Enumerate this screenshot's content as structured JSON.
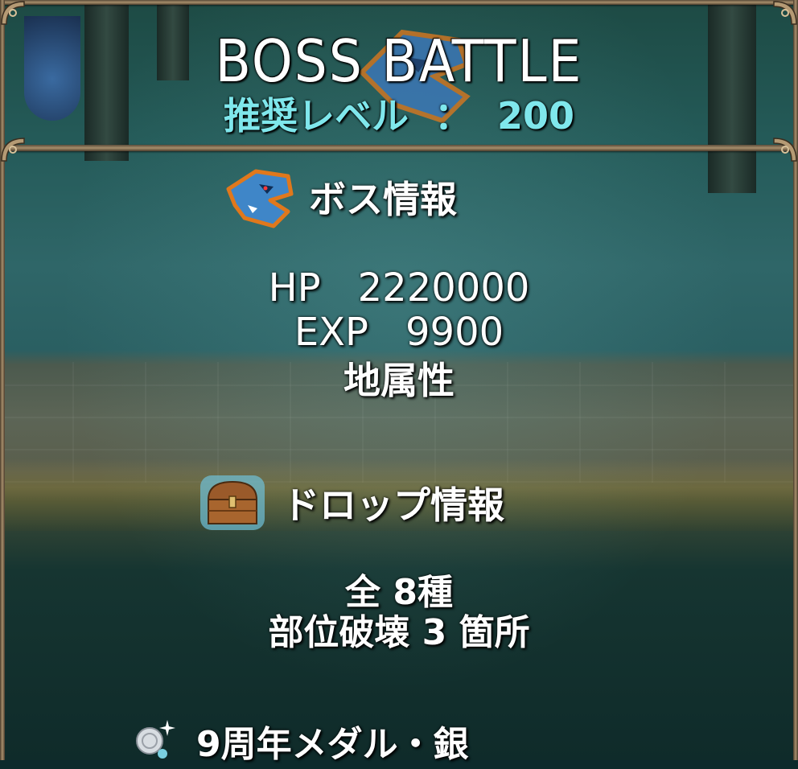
{
  "header": {
    "title": "BOSS BATTLE",
    "recommended_label": "推奨レベル",
    "separator": "：",
    "recommended_value": "200"
  },
  "boss_info": {
    "heading": "ボス情報",
    "icon": "boss-dragon-icon",
    "hp_label": "HP",
    "hp_value": "2220000",
    "exp_label": "EXP",
    "exp_value": "9900",
    "attribute": "地属性"
  },
  "drop_info": {
    "heading": "ドロップ情報",
    "icon": "treasure-chest-icon",
    "kinds": "全 8種",
    "part_break": "部位破壊 3 箇所"
  },
  "rewards": [
    {
      "icon": "silver-medal-icon",
      "label": "9周年メダル・銀"
    }
  ],
  "colors": {
    "title": "#ffffff",
    "level": "#7fe7ec",
    "frame": "#a88f6c"
  }
}
